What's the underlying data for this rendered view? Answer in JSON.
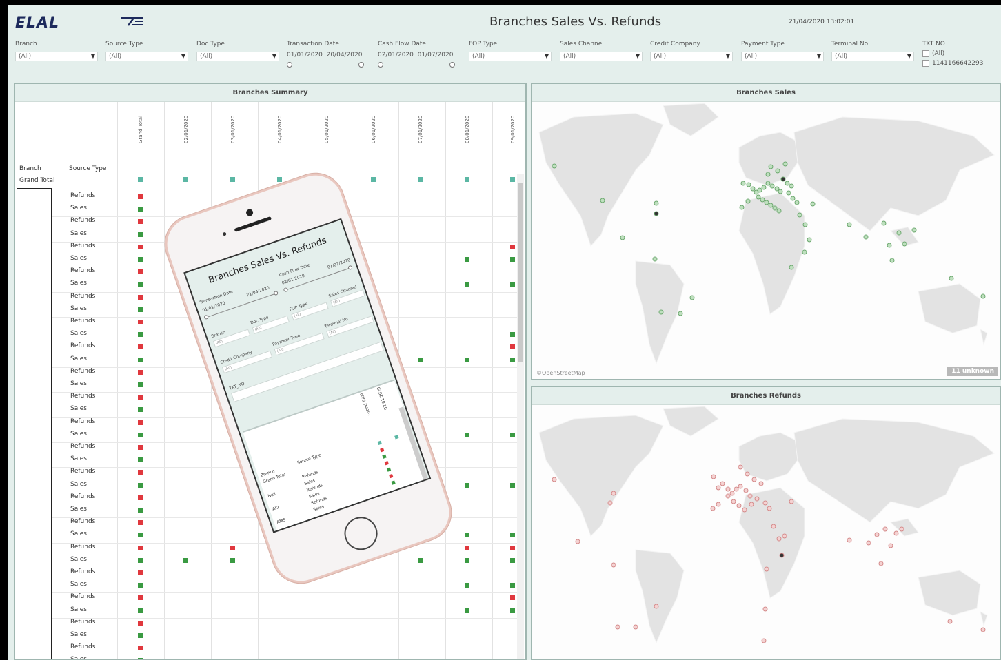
{
  "header": {
    "logo": "ELAL",
    "title": "Branches Sales Vs. Refunds",
    "timestamp": "21/04/2020 13:02:01"
  },
  "filters": {
    "branch": {
      "label": "Branch",
      "value": "(All)"
    },
    "source_type": {
      "label": "Source Type",
      "value": "(All)"
    },
    "doc_type": {
      "label": "Doc Type",
      "value": "(All)"
    },
    "transaction_date": {
      "label": "Transaction Date",
      "from": "01/01/2020",
      "to": "20/04/2020"
    },
    "cash_flow_date": {
      "label": "Cash Flow Date",
      "from": "02/01/2020",
      "to": "01/07/2020"
    },
    "fop_type": {
      "label": "FOP Type",
      "value": "(All)"
    },
    "sales_channel": {
      "label": "Sales Channel",
      "value": "(All)"
    },
    "credit_company": {
      "label": "Credit Company",
      "value": "(All)"
    },
    "payment_type": {
      "label": "Payment Type",
      "value": "(All)"
    },
    "terminal_no": {
      "label": "Terminal No",
      "value": "(All)"
    },
    "tkt_no": {
      "label": "TKT NO",
      "options": [
        "(All)",
        "1141166642293"
      ]
    }
  },
  "summary": {
    "title": "Branches Summary",
    "col_branch": "Branch",
    "col_source_type": "Source Type",
    "grand_total_col": "Grand Total",
    "grand_total_row": "Grand Total",
    "date_columns": [
      "02/01/2020",
      "03/01/2020",
      "04/01/2020",
      "05/01/2020",
      "06/01/2020",
      "07/01/2020",
      "08/01/2020",
      "09/01/2020"
    ],
    "row_labels": [
      "Refunds",
      "Sales",
      "Refunds",
      "Sales",
      "Refunds",
      "Sales",
      "Refunds",
      "Sales",
      "Refunds",
      "Sales",
      "Refunds",
      "Sales",
      "Refunds",
      "Sales",
      "Refunds",
      "Sales",
      "Refunds",
      "Sales",
      "Refunds",
      "Sales",
      "Refunds",
      "Sales",
      "Refunds",
      "Sales",
      "Refunds",
      "Sales",
      "Refunds",
      "Sales",
      "Refunds",
      "Sales",
      "Refunds",
      "Sales",
      "Refunds",
      "Sales",
      "Refunds",
      "Sales",
      "Refunds",
      "Sales",
      "Refunds"
    ]
  },
  "sales_map": {
    "title": "Branches Sales",
    "attribution": "©OpenStreetMap",
    "unknown_badge": "11 unknown"
  },
  "refunds_map": {
    "title": "Branches Refunds"
  },
  "phone_screen": {
    "title": "Branches Sales Vs. Refunds",
    "transaction_date": "Transaction Date",
    "cash_flow_date": "Cash Flow Date",
    "date_a": "01/01/2020",
    "date_b": "21/04/2020",
    "date_c": "02/01/2020",
    "date_d": "01/07/2020",
    "branch": "Branch",
    "doc_type": "Doc Type",
    "fop_type": "FOP Type",
    "sales_channel": "Sales Channel",
    "credit_company": "Credit Company",
    "payment_type": "Payment Type",
    "terminal_no": "Terminal No",
    "tkt_no": "TKT_NO",
    "all": "(All)",
    "tbl_branch": "Branch",
    "tbl_source": "Source Type",
    "tbl_grand": "Grand Total",
    "tbl_grand_col": "Grand Total",
    "tbl_date": "02/01/2020",
    "rows": [
      {
        "branch": "",
        "source": "Refunds"
      },
      {
        "branch": "Null",
        "source": "Sales"
      },
      {
        "branch": "",
        "source": "Refunds"
      },
      {
        "branch": "AKL",
        "source": "Sales"
      },
      {
        "branch": "",
        "source": "Refunds"
      },
      {
        "branch": "AMS",
        "source": "Sales"
      }
    ]
  },
  "colors": {
    "sales_green": "#3a9a42",
    "refund_red": "#e0383e",
    "total_teal": "#5bb7a4",
    "panel_bg": "#e4efec"
  }
}
